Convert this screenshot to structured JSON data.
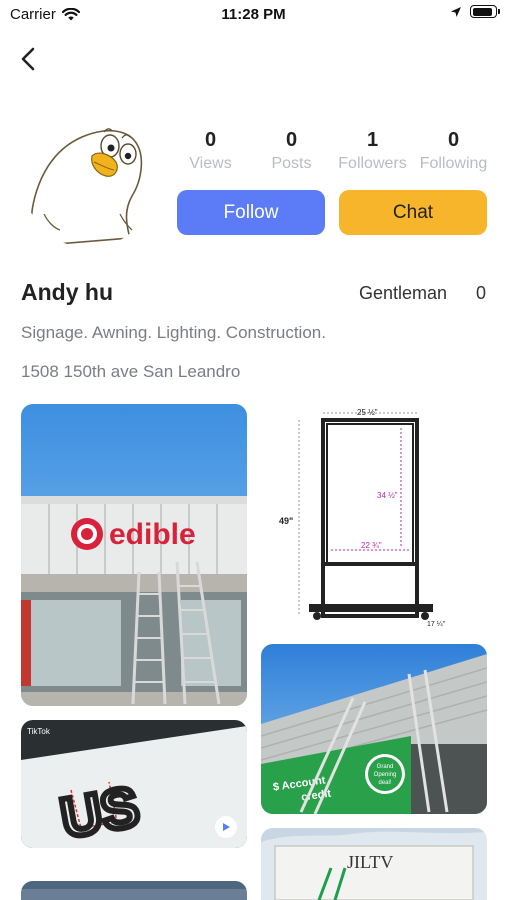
{
  "status_bar": {
    "carrier": "Carrier",
    "time": "11:28 PM",
    "battery_level": 0.9
  },
  "profile": {
    "name": "Andy hu",
    "rank_title": "Gentleman",
    "rank_value": "0",
    "bio": "Signage. Awning. Lighting. Construction.",
    "address": "1508 150th ave San Leandro",
    "stats": [
      {
        "value": "0",
        "label": "Views"
      },
      {
        "value": "0",
        "label": "Posts"
      },
      {
        "value": "1",
        "label": "Followers"
      },
      {
        "value": "0",
        "label": "Following"
      }
    ]
  },
  "actions": {
    "follow_label": "Follow",
    "chat_label": "Chat"
  },
  "feed": {
    "post1": {
      "sign_text": "edible"
    },
    "post2": {
      "dim_width": "25 ½\"",
      "dim_height": "49\"",
      "dim_inner_h": "34 ½\"",
      "dim_inner_w": "22 ¾\"",
      "dim_base": "17 ¼\""
    },
    "post3": {
      "sign_line1": "$ Account",
      "sign_line2": "credit",
      "badge_line1": "Grand",
      "badge_line2": "Opening",
      "badge_line3": "deal!"
    },
    "post4": {
      "letters": "US",
      "watermark": "TikTok"
    },
    "post5": {
      "truck_text": "JILTV"
    }
  },
  "colors": {
    "follow": "#5b7cf6",
    "chat": "#f7b52b",
    "muted": "#7a7d84"
  }
}
